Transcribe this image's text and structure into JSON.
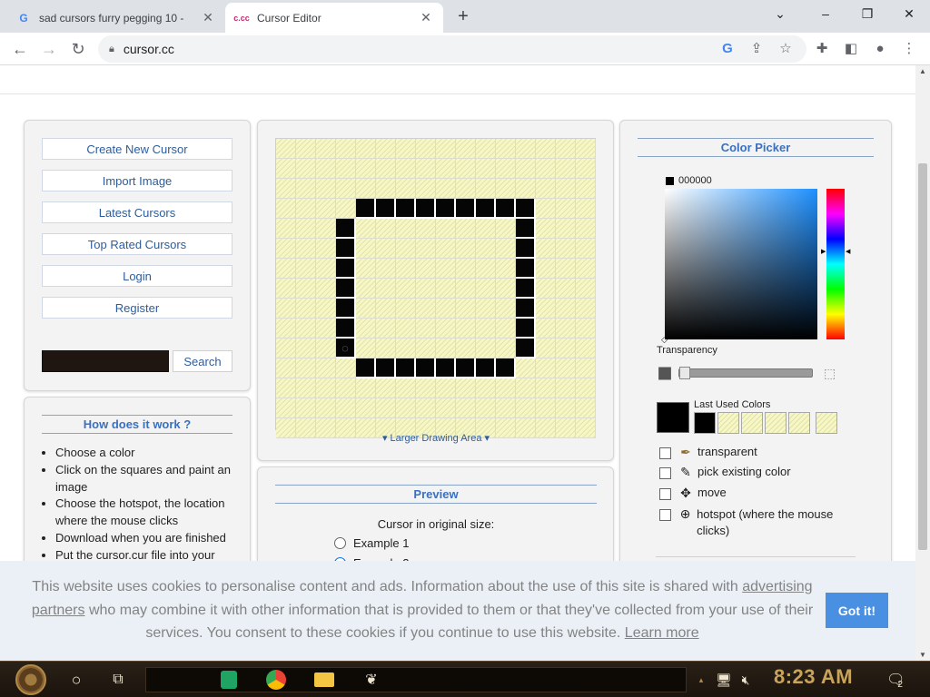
{
  "browser": {
    "tabs": [
      {
        "title": "sad cursors furry pegging 10 -",
        "favicon": "G"
      },
      {
        "title": "Cursor Editor",
        "favicon": "c.cc"
      }
    ],
    "new_tab": "+",
    "window_controls": [
      "⌄",
      "–",
      "❐",
      "✕"
    ],
    "address": "cursor.cc"
  },
  "sidebar": {
    "menu": [
      "Create New Cursor",
      "Import Image",
      "Latest Cursors",
      "Top Rated Cursors",
      "Login",
      "Register"
    ],
    "search_button": "Search"
  },
  "how": {
    "title": "How does it work ?",
    "steps": [
      "Choose a color",
      "Click on the squares and paint an image",
      "Choose the hotspot, the location where the mouse clicks",
      "Download when you are finished",
      "Put the cursor.cur file into your"
    ]
  },
  "editor": {
    "grid_cols": 16,
    "grid_rows": 15,
    "larger_link": "Larger Drawing Area",
    "black_cells": [
      [
        3,
        4
      ],
      [
        3,
        5
      ],
      [
        3,
        6
      ],
      [
        3,
        7
      ],
      [
        3,
        8
      ],
      [
        3,
        9
      ],
      [
        3,
        10
      ],
      [
        3,
        11
      ],
      [
        3,
        12
      ],
      [
        4,
        3
      ],
      [
        5,
        3
      ],
      [
        6,
        3
      ],
      [
        7,
        3
      ],
      [
        8,
        3
      ],
      [
        9,
        3
      ],
      [
        4,
        12
      ],
      [
        5,
        12
      ],
      [
        6,
        12
      ],
      [
        7,
        12
      ],
      [
        8,
        12
      ],
      [
        9,
        12
      ],
      [
        10,
        12
      ],
      [
        11,
        4
      ],
      [
        11,
        5
      ],
      [
        11,
        6
      ],
      [
        11,
        7
      ],
      [
        11,
        8
      ],
      [
        11,
        9
      ],
      [
        11,
        10
      ],
      [
        11,
        11
      ]
    ],
    "hotspot_cell": [
      10,
      3
    ]
  },
  "preview": {
    "title": "Preview",
    "subtitle": "Cursor in original size:",
    "example1": "Example 1",
    "example2": "Example 2"
  },
  "picker": {
    "title": "Color Picker",
    "hex": "000000",
    "transparency": "Transparency",
    "last_used": "Last Used Colors",
    "options": {
      "transparent": "transparent",
      "pick": "pick existing color",
      "move": "move",
      "hotspot": "hotspot (where the mouse clicks)"
    }
  },
  "cookie": {
    "text1": "This website uses cookies to personalise content and ads. Information about the use of this site is shared with",
    "link1": "advertising partners",
    "text2": "who may combine it with other information that is provided to them or that they've collected from your use of their services. You consent to these cookies if you continue to use this website.",
    "link2": "Learn more",
    "button": "Got it!"
  },
  "taskbar": {
    "time": "8:23 AM",
    "notification_count": "2"
  },
  "colors": {
    "accent": "#3a70c0",
    "cookie_button": "#4a90e2",
    "grid_fill": "#f7f7c6"
  }
}
